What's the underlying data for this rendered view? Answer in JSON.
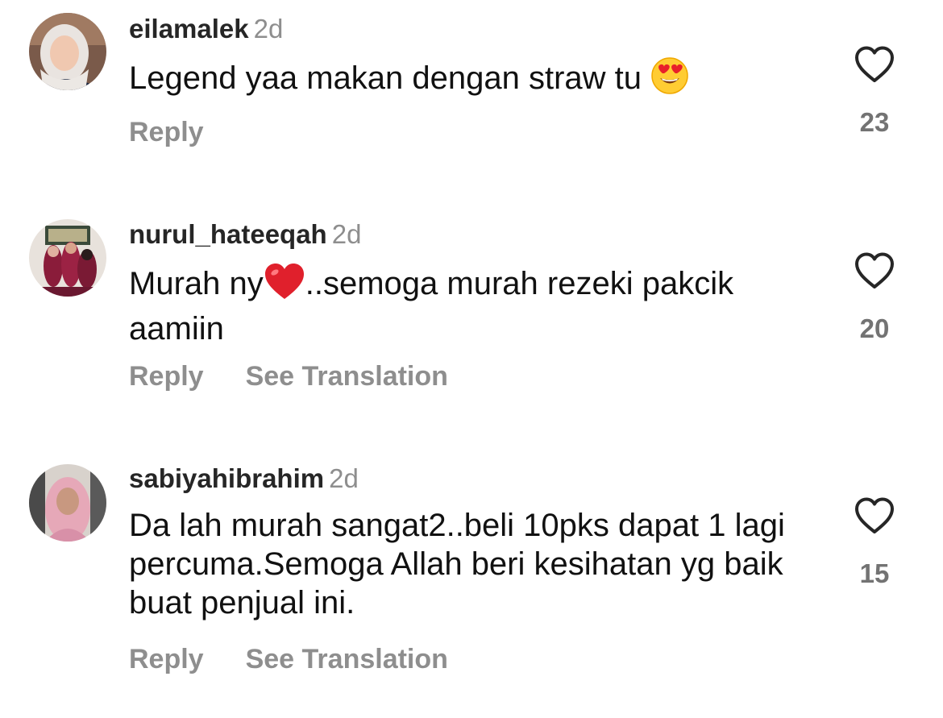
{
  "comments": [
    {
      "username": "eilamalek",
      "time": "2d",
      "text": "Legend yaa makan dengan straw tu",
      "emoji": "heart-eyes-emoji",
      "reply_label": "Reply",
      "translate_label": "",
      "likes": "23"
    },
    {
      "username": "nurul_hateeqah",
      "time": "2d",
      "text_before": "Murah ny",
      "emoji": "red-heart-emoji",
      "text_after": "..semoga murah rezeki pakcik aamiin",
      "reply_label": "Reply",
      "translate_label": "See Translation",
      "likes": "20"
    },
    {
      "username": "sabiyahibrahim",
      "time": "2d",
      "text": "Da lah murah sangat2..beli 10pks dapat 1 lagi percuma.Semoga Allah beri kesihatan yg baik buat penjual ini.",
      "reply_label": "Reply",
      "translate_label": "See Translation",
      "likes": "15"
    }
  ],
  "colors": {
    "secondary_text": "#8e8e8e",
    "primary_text": "#111111",
    "heart_outline": "#262626"
  }
}
